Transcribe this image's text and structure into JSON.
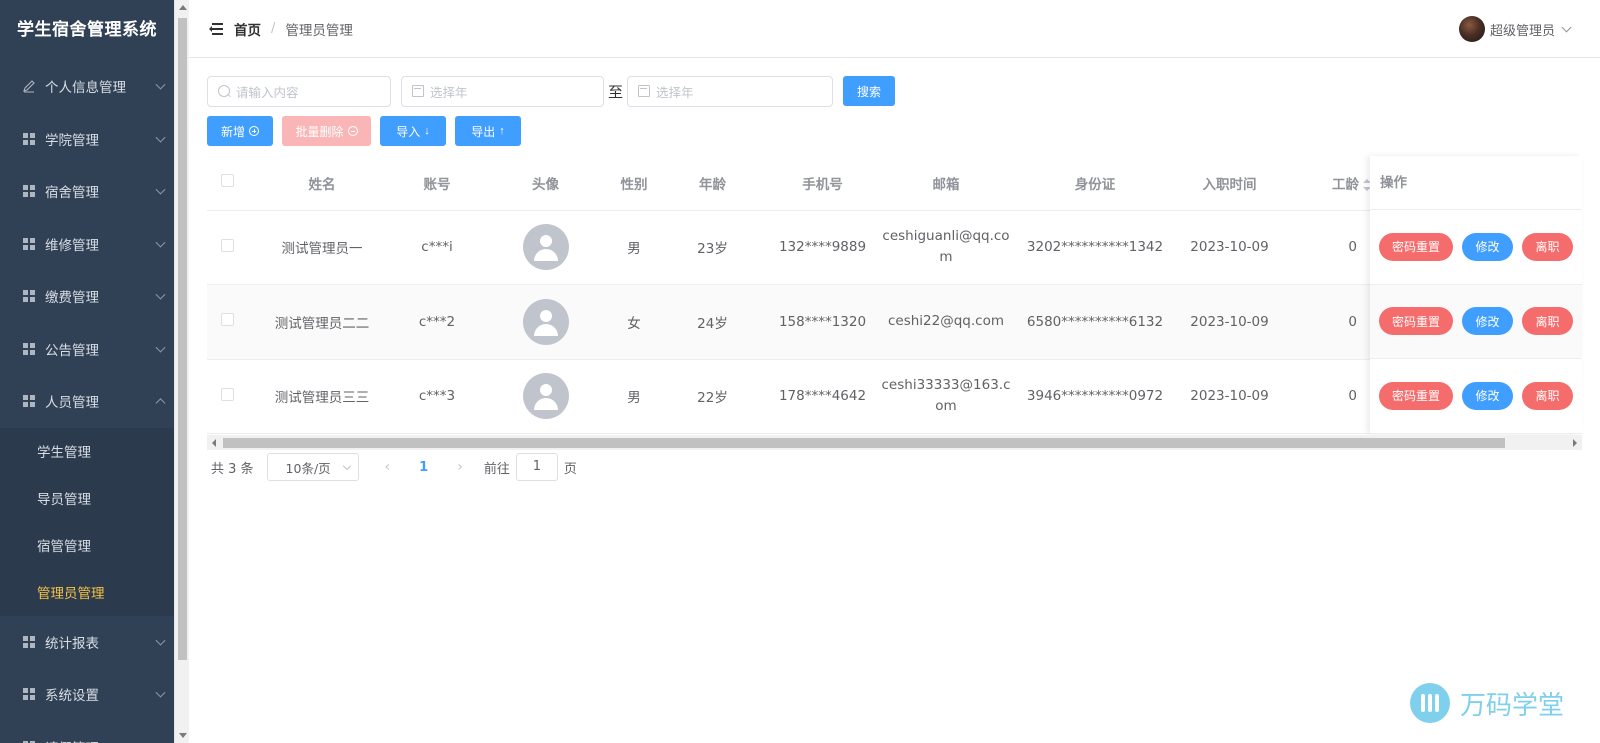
{
  "app": {
    "title": "学生宿舍管理系统"
  },
  "sidebar": {
    "items": [
      {
        "label": "个人信息管理",
        "icon": "edit-icon",
        "expanded": false
      },
      {
        "label": "学院管理",
        "icon": "grid-icon",
        "expanded": false
      },
      {
        "label": "宿舍管理",
        "icon": "grid-icon",
        "expanded": false
      },
      {
        "label": "维修管理",
        "icon": "grid-icon",
        "expanded": false
      },
      {
        "label": "缴费管理",
        "icon": "grid-icon",
        "expanded": false
      },
      {
        "label": "公告管理",
        "icon": "grid-icon",
        "expanded": false
      },
      {
        "label": "人员管理",
        "icon": "grid-icon",
        "expanded": true
      }
    ],
    "sub_items": [
      "学生管理",
      "导员管理",
      "宿管管理",
      "管理员管理"
    ],
    "active_sub": "管理员管理",
    "items_after": [
      {
        "label": "统计报表",
        "icon": "grid-icon"
      },
      {
        "label": "系统设置",
        "icon": "grid-icon"
      },
      {
        "label": "请假管理",
        "icon": "grid-icon"
      }
    ],
    "active_color": "#f5c244",
    "bg_color": "#304156"
  },
  "header": {
    "breadcrumb_home": "首页",
    "breadcrumb_separator": "/",
    "breadcrumb_current": "管理员管理",
    "user_name": "超级管理员"
  },
  "search": {
    "keyword_placeholder": "请输入内容",
    "year_start_placeholder": "选择年",
    "to_label": "至",
    "year_end_placeholder": "选择年",
    "search_button": "搜索"
  },
  "toolbar": {
    "add": "新增",
    "batch_delete": "批量删除",
    "import": "导入",
    "export": "导出"
  },
  "table": {
    "columns": [
      "姓名",
      "账号",
      "头像",
      "性别",
      "年龄",
      "手机号",
      "邮箱",
      "身份证",
      "入职时间",
      "工龄",
      "操作"
    ],
    "rows": [
      {
        "name": "测试管理员一",
        "account": "c***i",
        "gender": "男",
        "age": "23岁",
        "phone": "132****9889",
        "email": "ceshiguanli@qq.com",
        "id_card": "3202**********1342",
        "hire_date": "2023-10-09",
        "seniority": "0"
      },
      {
        "name": "测试管理员二二",
        "account": "c***2",
        "gender": "女",
        "age": "24岁",
        "phone": "158****1320",
        "email": "ceshi22@qq.com",
        "id_card": "6580**********6132",
        "hire_date": "2023-10-09",
        "seniority": "0"
      },
      {
        "name": "测试管理员三三",
        "account": "c***3",
        "gender": "男",
        "age": "22岁",
        "phone": "178****4642",
        "email": "ceshi33333@163.com",
        "id_card": "3946**********0972",
        "hire_date": "2023-10-09",
        "seniority": "0"
      }
    ],
    "actions": {
      "reset": "密码重置",
      "edit": "修改",
      "resign": "离职"
    }
  },
  "pagination": {
    "total": "共 3 条",
    "page_size": "10条/页",
    "current_page": "1",
    "goto_prefix": "前往",
    "goto_value": "1",
    "goto_suffix": "页"
  },
  "watermark": {
    "text": "万码学堂"
  }
}
